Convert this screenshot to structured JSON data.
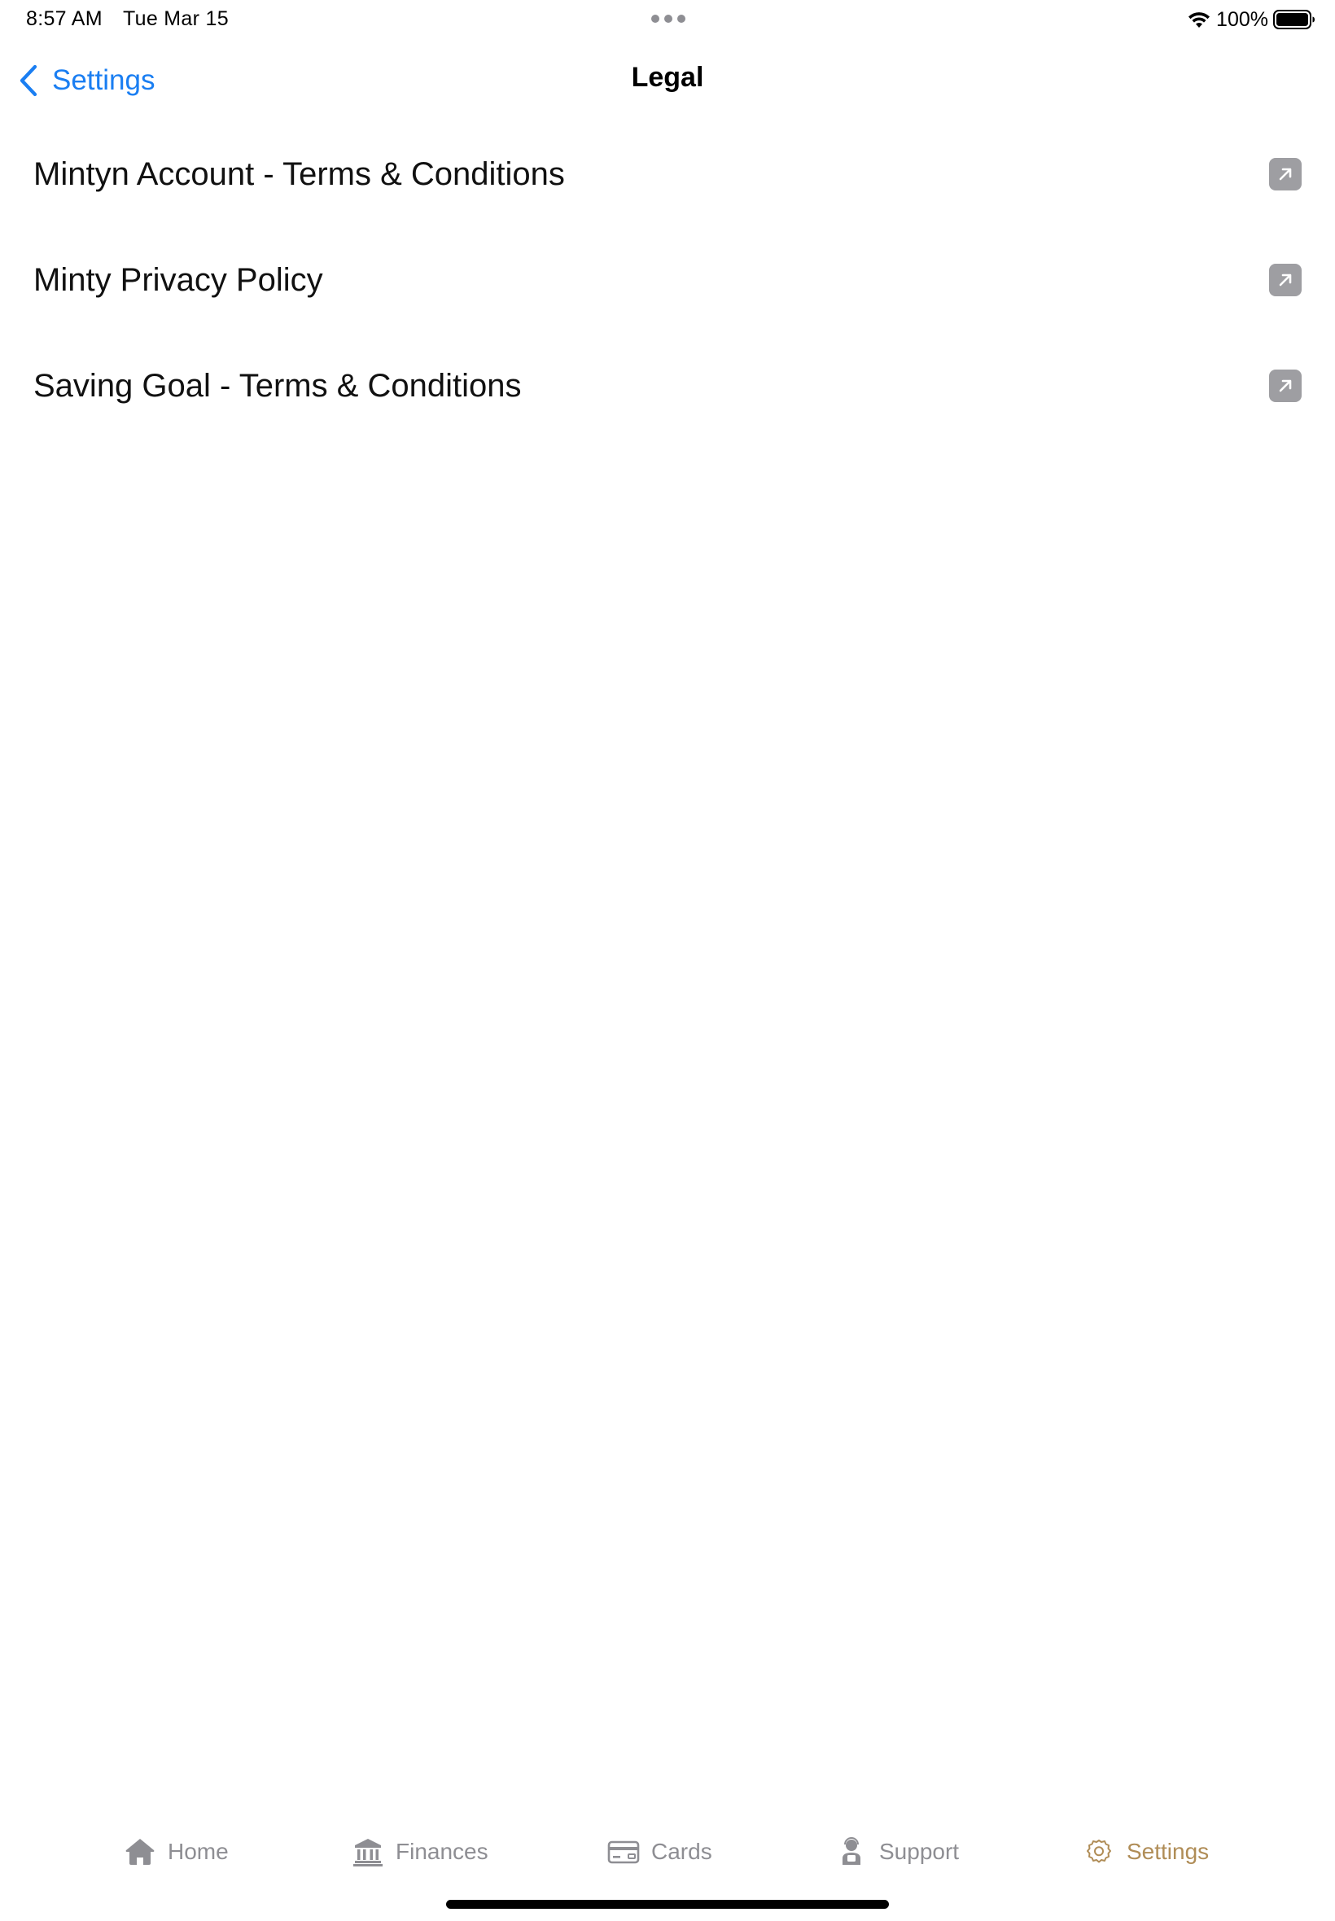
{
  "status_bar": {
    "time": "8:57 AM",
    "date": "Tue Mar 15",
    "battery": "100%"
  },
  "nav": {
    "back_label": "Settings",
    "title": "Legal"
  },
  "legal_items": [
    {
      "label": "Mintyn Account - Terms & Conditions",
      "icon": "external-link-icon"
    },
    {
      "label": "Minty Privacy Policy",
      "icon": "external-link-icon"
    },
    {
      "label": "Saving Goal - Terms & Conditions",
      "icon": "external-link-icon"
    }
  ],
  "tabs": [
    {
      "label": "Home",
      "icon": "house-icon",
      "active": false
    },
    {
      "label": "Finances",
      "icon": "bank-icon",
      "active": false
    },
    {
      "label": "Cards",
      "icon": "card-icon",
      "active": false
    },
    {
      "label": "Support",
      "icon": "support-agent-icon",
      "active": false
    },
    {
      "label": "Settings",
      "icon": "gear-icon",
      "active": true
    }
  ],
  "colors": {
    "accent_blue": "#1a7ef2",
    "tab_active": "#b08d57",
    "tab_inactive": "#8e8e93",
    "icon_gray": "#9e9ea2"
  }
}
